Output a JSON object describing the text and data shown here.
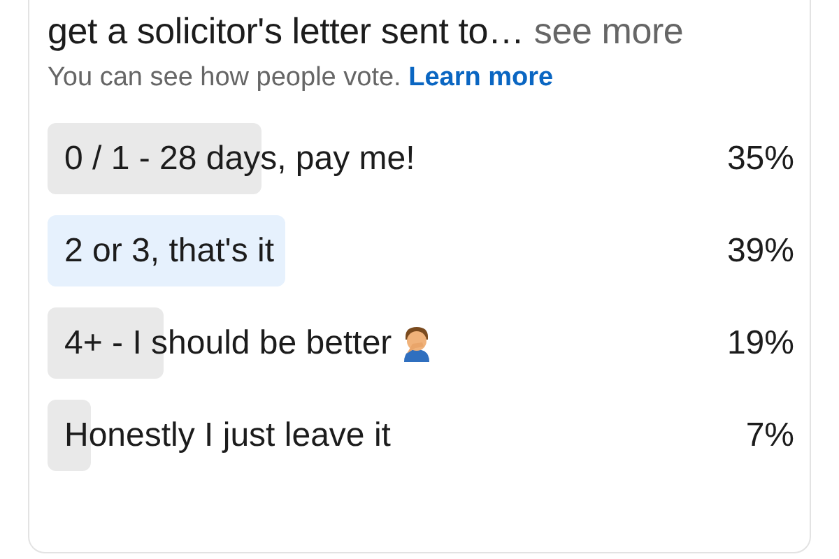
{
  "post": {
    "text": "get a solicitor's letter sent to…",
    "see_more": "see more"
  },
  "poll": {
    "notice": "You can see how people vote.",
    "learn_more": "Learn more",
    "options": [
      {
        "label": "0 / 1 - 28 days, pay me!",
        "percent": "35%",
        "selected": false
      },
      {
        "label": "2 or 3, that's it",
        "percent": "39%",
        "selected": true
      },
      {
        "label": "4+ - I should be better",
        "emoji": true,
        "percent": "19%",
        "selected": false
      },
      {
        "label": "Honestly I just leave it",
        "percent": "7%",
        "selected": false
      }
    ]
  }
}
